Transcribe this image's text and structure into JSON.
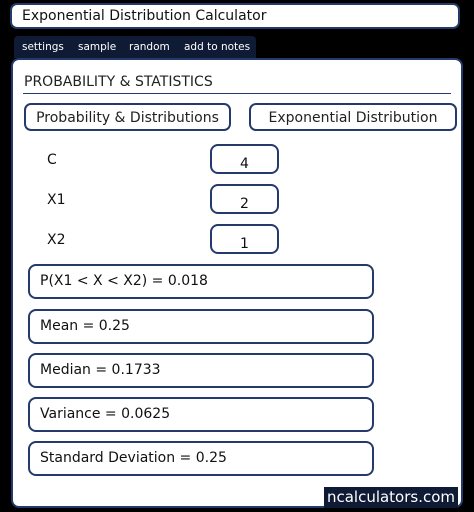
{
  "app": {
    "title": "Exponential Distribution Calculator"
  },
  "menu": {
    "items": [
      {
        "label": "settings"
      },
      {
        "label": "sample"
      },
      {
        "label": "random"
      },
      {
        "label": "add to notes"
      }
    ]
  },
  "section": {
    "title": "PROBABILITY & STATISTICS"
  },
  "breadcrumbs": [
    {
      "label": "Probability & Distributions"
    },
    {
      "label": "Exponential Distribution"
    }
  ],
  "inputs": [
    {
      "label": "C",
      "value": "4"
    },
    {
      "label": "X1",
      "value": "2"
    },
    {
      "label": "X2",
      "value": "1"
    }
  ],
  "results": [
    {
      "text": "P(X1 < X < X2)  =  0.018"
    },
    {
      "text": "Mean  =  0.25"
    },
    {
      "text": "Median  =  0.1733"
    },
    {
      "text": "Variance  =  0.0625"
    },
    {
      "text": "Standard Deviation  =  0.25"
    }
  ],
  "brand": {
    "label": "ncalculators.com"
  },
  "colors": {
    "accent": "#243a6b",
    "menu_background": "#0f1b35",
    "page_background": "#000000"
  }
}
